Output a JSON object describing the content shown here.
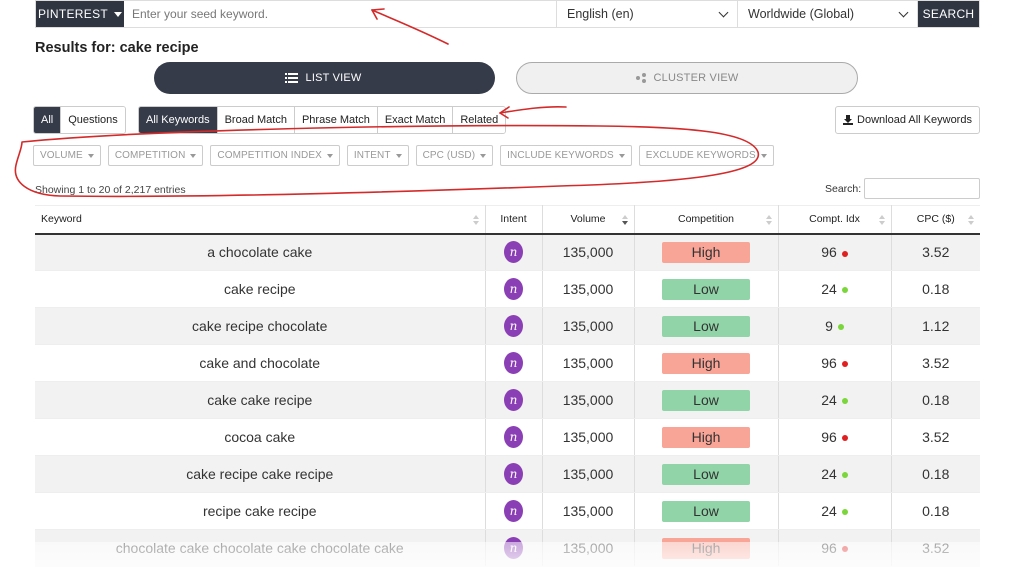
{
  "search": {
    "platform": "PINTEREST",
    "placeholder": "Enter your seed keyword.",
    "language": "English (en)",
    "region": "Worldwide (Global)",
    "search_label": "SEARCH"
  },
  "results_title": "Results for: cake recipe",
  "views": {
    "list": "LIST VIEW",
    "cluster": "CLUSTER VIEW",
    "active": "list"
  },
  "type_tabs": [
    {
      "label": "All",
      "active": true
    },
    {
      "label": "Questions",
      "active": false
    }
  ],
  "match_tabs": [
    {
      "label": "All Keywords",
      "active": true
    },
    {
      "label": "Broad Match",
      "active": false
    },
    {
      "label": "Phrase Match",
      "active": false
    },
    {
      "label": "Exact Match",
      "active": false
    },
    {
      "label": "Related",
      "active": false
    }
  ],
  "download_label": "Download All Keywords",
  "filters": [
    "VOLUME",
    "COMPETITION",
    "COMPETITION INDEX",
    "INTENT",
    "CPC (USD)",
    "INCLUDE KEYWORDS",
    "EXCLUDE KEYWORDS"
  ],
  "entries_text": "Showing 1 to 20 of 2,217 entries",
  "table_search_label": "Search:",
  "columns": [
    "Keyword",
    "Intent",
    "Volume",
    "Competition",
    "Compt. Idx",
    "CPC ($)"
  ],
  "rows": [
    {
      "keyword": "a chocolate cake",
      "intent": "n",
      "volume": "135,000",
      "competition": "High",
      "idx": "96",
      "cpc": "3.52"
    },
    {
      "keyword": "cake recipe",
      "intent": "n",
      "volume": "135,000",
      "competition": "Low",
      "idx": "24",
      "cpc": "0.18"
    },
    {
      "keyword": "cake recipe chocolate",
      "intent": "n",
      "volume": "135,000",
      "competition": "Low",
      "idx": "9",
      "cpc": "1.12"
    },
    {
      "keyword": "cake and chocolate",
      "intent": "n",
      "volume": "135,000",
      "competition": "High",
      "idx": "96",
      "cpc": "3.52"
    },
    {
      "keyword": "cake cake recipe",
      "intent": "n",
      "volume": "135,000",
      "competition": "Low",
      "idx": "24",
      "cpc": "0.18"
    },
    {
      "keyword": "cocoa cake",
      "intent": "n",
      "volume": "135,000",
      "competition": "High",
      "idx": "96",
      "cpc": "3.52"
    },
    {
      "keyword": "cake recipe cake recipe",
      "intent": "n",
      "volume": "135,000",
      "competition": "Low",
      "idx": "24",
      "cpc": "0.18"
    },
    {
      "keyword": "recipe cake recipe",
      "intent": "n",
      "volume": "135,000",
      "competition": "Low",
      "idx": "24",
      "cpc": "0.18"
    },
    {
      "keyword": "chocolate cake chocolate cake chocolate cake",
      "intent": "n",
      "volume": "135,000",
      "competition": "High",
      "idx": "96",
      "cpc": "3.52"
    }
  ],
  "colors": {
    "dark": "#353b48",
    "high": "#f8a497",
    "low": "#90d4a8",
    "intent": "#8b3fb5",
    "annotation": "#d42a2a"
  }
}
